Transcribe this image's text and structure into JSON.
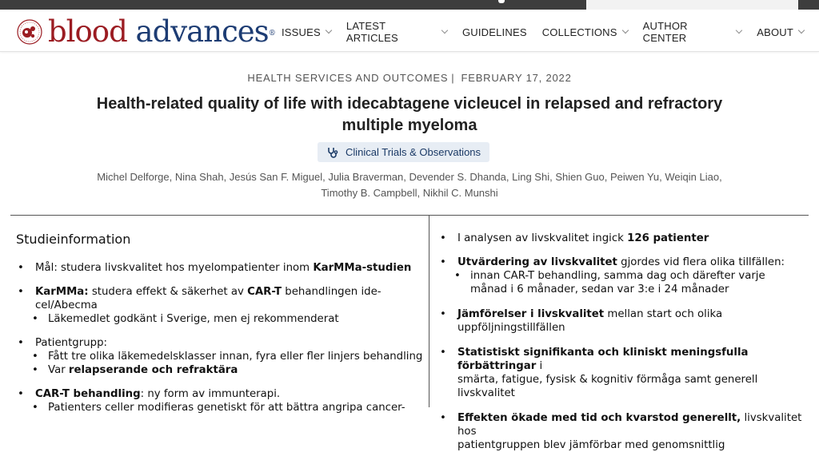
{
  "colors": {
    "brand_red": "#9b1c22",
    "brand_blue": "#1d3c73",
    "badge_bg": "#e7edf4"
  },
  "logo": {
    "word1": "blood",
    "word2": "advances",
    "icon": "blood-cell-logo-icon"
  },
  "nav": [
    {
      "label": "ISSUES",
      "has_menu": true
    },
    {
      "label": "LATEST ARTICLES",
      "has_menu": true
    },
    {
      "label": "GUIDELINES",
      "has_menu": false
    },
    {
      "label": "COLLECTIONS",
      "has_menu": true
    },
    {
      "label": "AUTHOR CENTER",
      "has_menu": true
    },
    {
      "label": "ABOUT",
      "has_menu": true
    }
  ],
  "article": {
    "category": "HEALTH SERVICES AND OUTCOMES",
    "separator": "|",
    "date": "FEBRUARY 17, 2022",
    "title": "Health-related quality of life with idecabtagene vicleucel in relapsed and refractory multiple myeloma",
    "badge": "Clinical Trials & Observations",
    "badge_icon": "stethoscope-icon",
    "authors_line1": "Michel Delforge, Nina Shah, Jesús San F. Miguel, Julia Braverman, Devender S. Dhanda, Ling Shi, Shien Guo, Peiwen Yu, Weiqin Liao,",
    "authors_line2": "Timothy B. Campbell, Nikhil C. Munshi"
  },
  "summary": {
    "left_title": "Studieinformation",
    "left": {
      "b1_pre": "Mål: studera livskvalitet hos myelompatienter inom ",
      "b1_bold": "KarMMa-studien",
      "b2_bold": "KarMMa:",
      "b2_pre": " studera effekt & säkerhet av ",
      "b2_bold2": "CAR-T",
      "b2_post": " behandlingen ide-cel/Abecma",
      "b2_sub": "Läkemedlet godkänt i Sverige, men ej rekommenderat",
      "b3": "Patientgrupp:",
      "b3_sub1": "Fått tre olika läkemedelsklasser innan, fyra eller fler linjers behandling",
      "b3_sub2_pre": "Var ",
      "b3_sub2_bold": "relapserande och refraktära",
      "b4_bold": "CAR-T behandling",
      "b4_post": ": ny form av immunterapi.",
      "b4_sub": "Patienters celler modifieras genetiskt för att bättra angripa cancer-"
    },
    "right": {
      "r1_pre": "I analysen av livskvalitet ingick ",
      "r1_bold": "126 patienter",
      "r2_bold": "Utvärdering av livskvalitet",
      "r2_post": " gjordes vid flera olika tillfällen:",
      "r2_sub_l1": "innan CAR-T behandling, samma dag och därefter varje",
      "r2_sub_l2": "månad i 6 månader, sedan var 3:e i 24 månader",
      "r3_bold": "Jämförelser i livskvalitet",
      "r3_post": " mellan start och olika uppföljningstillfällen",
      "r4_bold": "Statistiskt signifikanta och kliniskt meningsfulla förbättringar",
      "r4_l1_post": " i",
      "r4_l2": "smärta, fatigue, fysisk & kognitiv förmåga samt generell livskvalitet",
      "r5_bold": "Effekten ökade med tid och kvarstod generellt,",
      "r5_l1_post": " livskvalitet hos",
      "r5_l2": "patientgruppen blev jämförbar med genomsnittlig"
    }
  }
}
